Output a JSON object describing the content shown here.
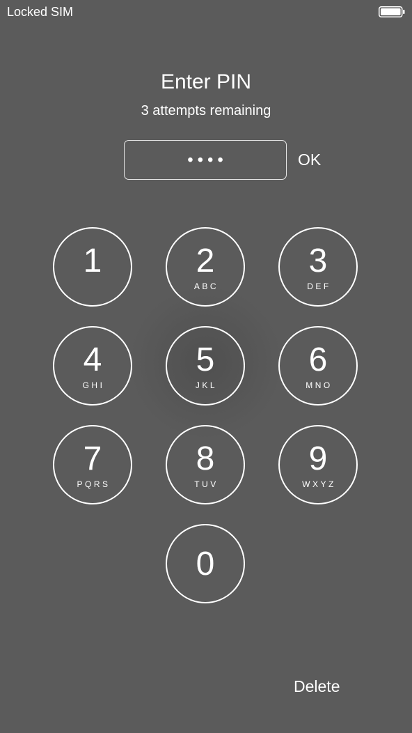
{
  "status_bar": {
    "carrier": "Locked SIM",
    "battery_icon": "battery-full-icon"
  },
  "title": "Enter PIN",
  "subtitle": "3 attempts remaining",
  "pin_field": {
    "value": "••••"
  },
  "ok_label": "OK",
  "keypad": {
    "keys": [
      {
        "digit": "1",
        "letters": ""
      },
      {
        "digit": "2",
        "letters": "ABC"
      },
      {
        "digit": "3",
        "letters": "DEF"
      },
      {
        "digit": "4",
        "letters": "GHI"
      },
      {
        "digit": "5",
        "letters": "JKL"
      },
      {
        "digit": "6",
        "letters": "MNO"
      },
      {
        "digit": "7",
        "letters": "PQRS"
      },
      {
        "digit": "8",
        "letters": "TUV"
      },
      {
        "digit": "9",
        "letters": "WXYZ"
      },
      {
        "digit": "0",
        "letters": ""
      }
    ]
  },
  "delete_label": "Delete",
  "colors": {
    "background": "#5b5b5b",
    "foreground": "#ffffff"
  }
}
